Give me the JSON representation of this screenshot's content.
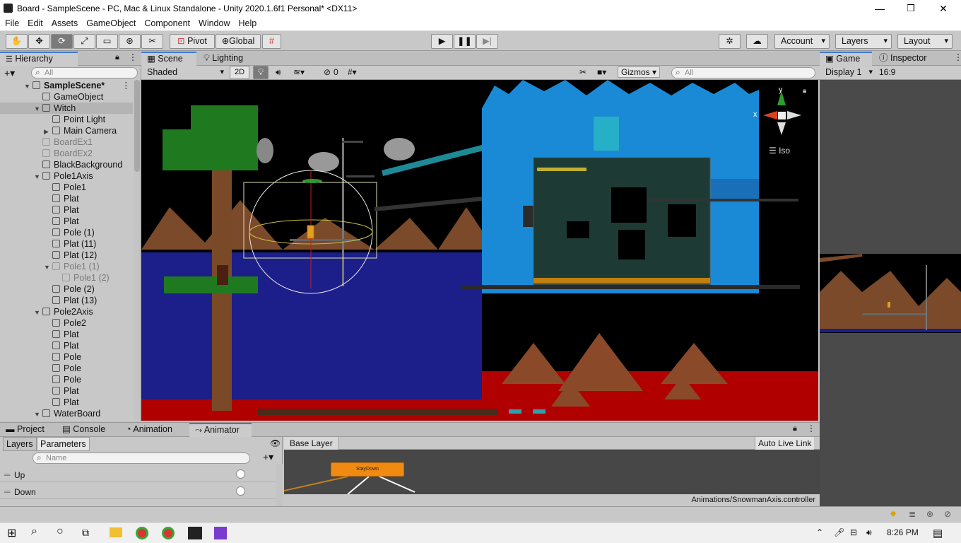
{
  "window": {
    "title": "Board - SampleScene - PC, Mac & Linux Standalone - Unity 2020.1.6f1 Personal* <DX11>",
    "minimize": "—",
    "maximize": "❐",
    "close": "✕"
  },
  "menu": [
    "File",
    "Edit",
    "Assets",
    "GameObject",
    "Component",
    "Window",
    "Help"
  ],
  "toolbar": {
    "tools": [
      "hand-tool-icon",
      "move-tool-icon",
      "rotate-tool-icon",
      "scale-tool-icon",
      "rect-tool-icon",
      "transform-tool-icon",
      "custom-tool-icon"
    ],
    "pivot": "Pivot",
    "global": "Global",
    "account": "Account",
    "layers": "Layers",
    "layout": "Layout"
  },
  "hierarchy": {
    "tab": "Hierarchy",
    "search_placeholder": "All",
    "rows": [
      {
        "label": "SampleScene*",
        "depth": 0,
        "expand": "▼",
        "kind": "scene",
        "style": "bold"
      },
      {
        "label": "GameObject",
        "depth": 1,
        "expand": "",
        "kind": "cube",
        "style": "normal"
      },
      {
        "label": "Witch",
        "depth": 1,
        "expand": "▼",
        "kind": "cube",
        "style": "selected"
      },
      {
        "label": "Point Light",
        "depth": 2,
        "expand": "",
        "kind": "cube",
        "style": "normal"
      },
      {
        "label": "Main Camera",
        "depth": 2,
        "expand": "▶",
        "kind": "cube",
        "style": "normal"
      },
      {
        "label": "BoardEx1",
        "depth": 1,
        "expand": "",
        "kind": "cube",
        "style": "dim"
      },
      {
        "label": "BoardEx2",
        "depth": 1,
        "expand": "",
        "kind": "cube",
        "style": "dim"
      },
      {
        "label": "BlackBackground",
        "depth": 1,
        "expand": "",
        "kind": "cube",
        "style": "normal"
      },
      {
        "label": "Pole1Axis",
        "depth": 1,
        "expand": "▼",
        "kind": "cube",
        "style": "normal"
      },
      {
        "label": "Pole1",
        "depth": 2,
        "expand": "",
        "kind": "cube",
        "style": "normal"
      },
      {
        "label": "Plat",
        "depth": 2,
        "expand": "",
        "kind": "cube",
        "style": "normal"
      },
      {
        "label": "Plat",
        "depth": 2,
        "expand": "",
        "kind": "cube",
        "style": "normal"
      },
      {
        "label": "Plat",
        "depth": 2,
        "expand": "",
        "kind": "cube",
        "style": "normal"
      },
      {
        "label": "Pole (1)",
        "depth": 2,
        "expand": "",
        "kind": "cube",
        "style": "normal"
      },
      {
        "label": "Plat (11)",
        "depth": 2,
        "expand": "",
        "kind": "cube",
        "style": "normal"
      },
      {
        "label": "Plat (12)",
        "depth": 2,
        "expand": "",
        "kind": "cube",
        "style": "normal"
      },
      {
        "label": "Pole1 (1)",
        "depth": 2,
        "expand": "▼",
        "kind": "cube",
        "style": "dim"
      },
      {
        "label": "Pole1 (2)",
        "depth": 3,
        "expand": "",
        "kind": "cube",
        "style": "dim"
      },
      {
        "label": "Pole (2)",
        "depth": 2,
        "expand": "",
        "kind": "cube",
        "style": "normal"
      },
      {
        "label": "Plat (13)",
        "depth": 2,
        "expand": "",
        "kind": "cube",
        "style": "normal"
      },
      {
        "label": "Pole2Axis",
        "depth": 1,
        "expand": "▼",
        "kind": "cube",
        "style": "normal"
      },
      {
        "label": "Pole2",
        "depth": 2,
        "expand": "",
        "kind": "cube",
        "style": "normal"
      },
      {
        "label": "Plat",
        "depth": 2,
        "expand": "",
        "kind": "cube",
        "style": "normal"
      },
      {
        "label": "Plat",
        "depth": 2,
        "expand": "",
        "kind": "cube",
        "style": "normal"
      },
      {
        "label": "Pole",
        "depth": 2,
        "expand": "",
        "kind": "cube",
        "style": "normal"
      },
      {
        "label": "Pole",
        "depth": 2,
        "expand": "",
        "kind": "cube",
        "style": "normal"
      },
      {
        "label": "Pole",
        "depth": 2,
        "expand": "",
        "kind": "cube",
        "style": "normal"
      },
      {
        "label": "Plat",
        "depth": 2,
        "expand": "",
        "kind": "cube",
        "style": "normal"
      },
      {
        "label": "Plat",
        "depth": 2,
        "expand": "",
        "kind": "cube",
        "style": "normal"
      },
      {
        "label": "WaterBoard",
        "depth": 1,
        "expand": "▼",
        "kind": "cube",
        "style": "normal"
      }
    ]
  },
  "scene": {
    "tabs": [
      "Scene",
      "Lighting"
    ],
    "shading": "Shaded",
    "mode2d": "2D",
    "hidden_count": "0",
    "gizmos": "Gizmos",
    "search_placeholder": "All",
    "iso": "Iso",
    "gizmo_x": "x",
    "gizmo_y": "y"
  },
  "game": {
    "tabs": [
      "Game",
      "Inspector"
    ],
    "display": "Display 1",
    "aspect": "16:9"
  },
  "bottom": {
    "tabs": [
      "Project",
      "Console",
      "Animation",
      "Animator"
    ],
    "subtabs": [
      "Layers",
      "Parameters"
    ],
    "name_placeholder": "Name",
    "params": [
      "Up",
      "Down"
    ],
    "base_layer": "Base Layer",
    "auto_live_link": "Auto Live Link",
    "state_name": "StayDown",
    "controller_path": "Animations/SnowmanAxis.controller"
  },
  "taskbar": {
    "time": "8:26 PM"
  }
}
